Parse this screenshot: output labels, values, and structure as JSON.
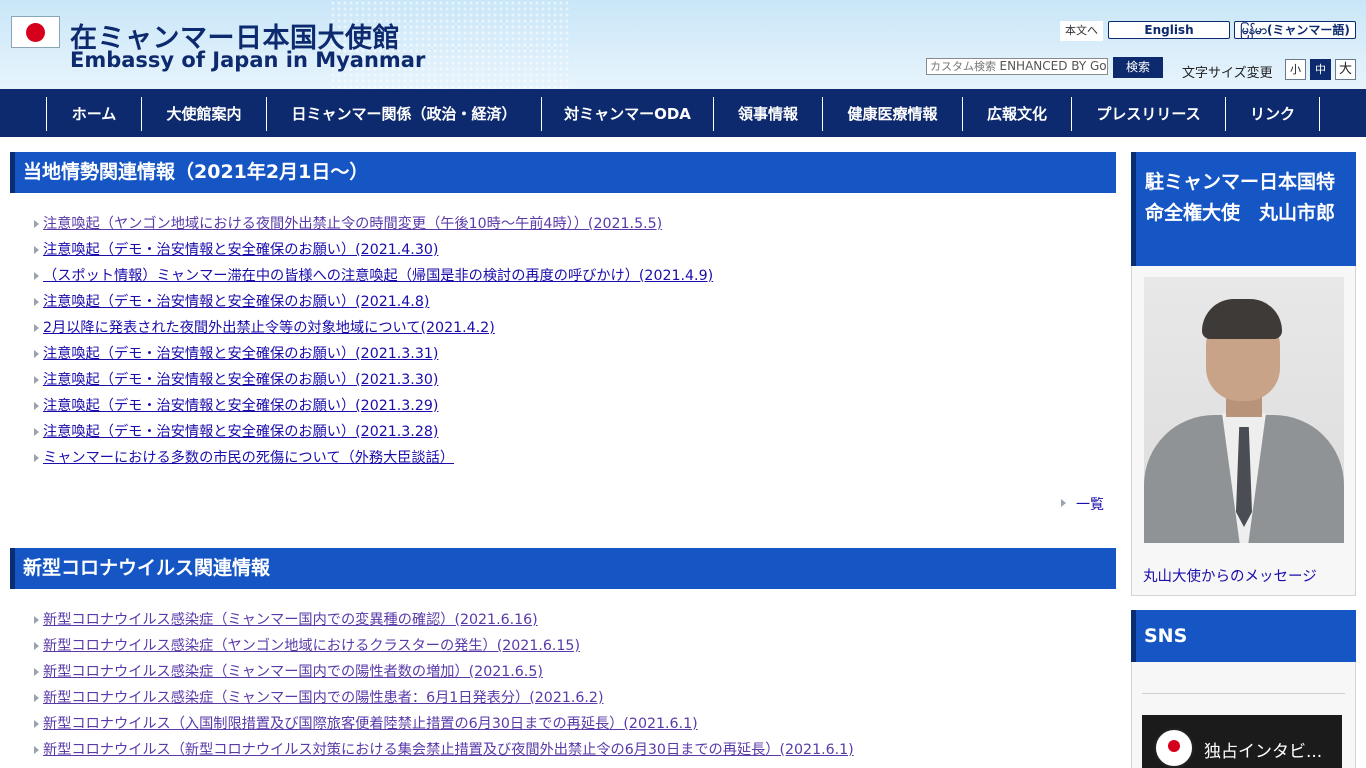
{
  "header": {
    "site_title_ja": "在ミャンマー日本国大使館",
    "site_title_en": "Embassy of Japan in Myanmar",
    "skip_link": "本文へ",
    "lang_en": "English",
    "lang_my": "မြန်မာ(ミャンマー語)",
    "search_placeholder": "カスタム検索",
    "search_brand": "ENHANCED BY Google",
    "search_button": "検索",
    "font_size_label": "文字サイズ変更",
    "font_small": "小",
    "font_medium": "中",
    "font_large": "大"
  },
  "nav": {
    "items": [
      "ホーム",
      "大使館案内",
      "日ミャンマー関係（政治・経済）",
      "対ミャンマーODA",
      "領事情報",
      "健康医療情報",
      "広報文化",
      "プレスリリース",
      "リンク"
    ]
  },
  "sections": {
    "situation": {
      "heading": "当地情勢関連情報（2021年2月1日〜）",
      "items": [
        "注意喚起（ヤンゴン地域における夜間外出禁止令の時間変更（午後10時〜午前4時））(2021.5.5)",
        "注意喚起（デモ・治安情報と安全確保のお願い）(2021.4.30)",
        "（スポット情報）ミャンマー滞在中の皆様への注意喚起（帰国是非の検討の再度の呼びかけ）(2021.4.9)",
        "注意喚起（デモ・治安情報と安全確保のお願い）(2021.4.8)",
        "2月以降に発表された夜間外出禁止令等の対象地域について(2021.4.2)",
        "注意喚起（デモ・治安情報と安全確保のお願い）(2021.3.31)",
        "注意喚起（デモ・治安情報と安全確保のお願い）(2021.3.30)",
        "注意喚起（デモ・治安情報と安全確保のお願い）(2021.3.29)",
        "注意喚起（デモ・治安情報と安全確保のお願い）(2021.3.28)",
        "ミャンマーにおける多数の市民の死傷について（外務大臣談話）"
      ],
      "more": "一覧"
    },
    "covid": {
      "heading": "新型コロナウイルス関連情報",
      "items": [
        "新型コロナウイルス感染症（ミャンマー国内での変異種の確認）(2021.6.16)",
        "新型コロナウイルス感染症（ヤンゴン地域におけるクラスターの発生）(2021.6.15)",
        "新型コロナウイルス感染症（ミャンマー国内での陽性者数の増加）(2021.6.5)",
        "新型コロナウイルス感染症（ミャンマー国内での陽性患者：6月1日発表分）(2021.6.2)",
        "新型コロナウイルス（入国制限措置及び国際旅客便着陸禁止措置の6月30日までの再延長）(2021.6.1)",
        "新型コロナウイルス（新型コロナウイルス対策における集会禁止措置及び夜間外出禁止令の6月30日までの再延長）(2021.6.1)"
      ]
    }
  },
  "sidebar": {
    "ambassador_heading": "駐ミャンマー日本国特命全権大使　丸山市郎",
    "ambassador_message": "丸山大使からのメッセージ",
    "sns_heading": "SNS",
    "video_title": "独占インタビ..."
  }
}
